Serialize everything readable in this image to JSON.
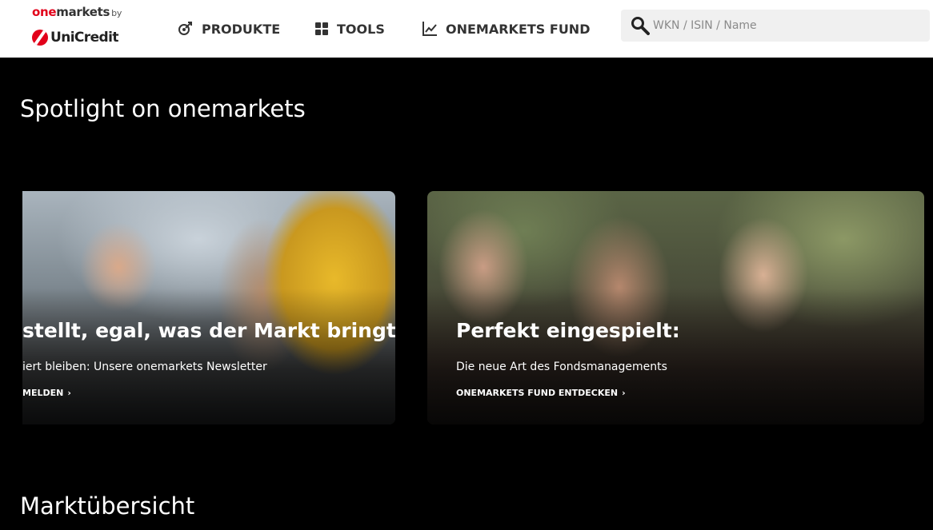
{
  "header": {
    "logo": {
      "brand_one": "one",
      "brand_markets": "markets",
      "brand_by": "by",
      "company": "UniCredit"
    },
    "nav": [
      {
        "label": "PRODUKTE",
        "icon": "product-icon"
      },
      {
        "label": "TOOLS",
        "icon": "grid-icon"
      },
      {
        "label": "ONEMARKETS FUND",
        "icon": "chart-line-icon"
      }
    ],
    "search": {
      "placeholder": "WKN / ISIN / Name",
      "value": ""
    }
  },
  "spotlight": {
    "title": "Spotlight on onemarkets",
    "cards": [
      {
        "headline": "stellt, egal, was der Markt bringt.",
        "subline": "iert bleiben: Unsere onemarkets Newsletter",
        "link": "MELDEN"
      },
      {
        "headline": "Perfekt eingespielt:",
        "subline": "Die neue Art des Fondsmanagements",
        "link": "ONEMARKETS FUND ENTDECKEN"
      }
    ]
  },
  "market": {
    "title": "Marktübersicht"
  },
  "colors": {
    "accent": "#e2001a",
    "background": "#000000",
    "header_bg": "#ffffff"
  }
}
